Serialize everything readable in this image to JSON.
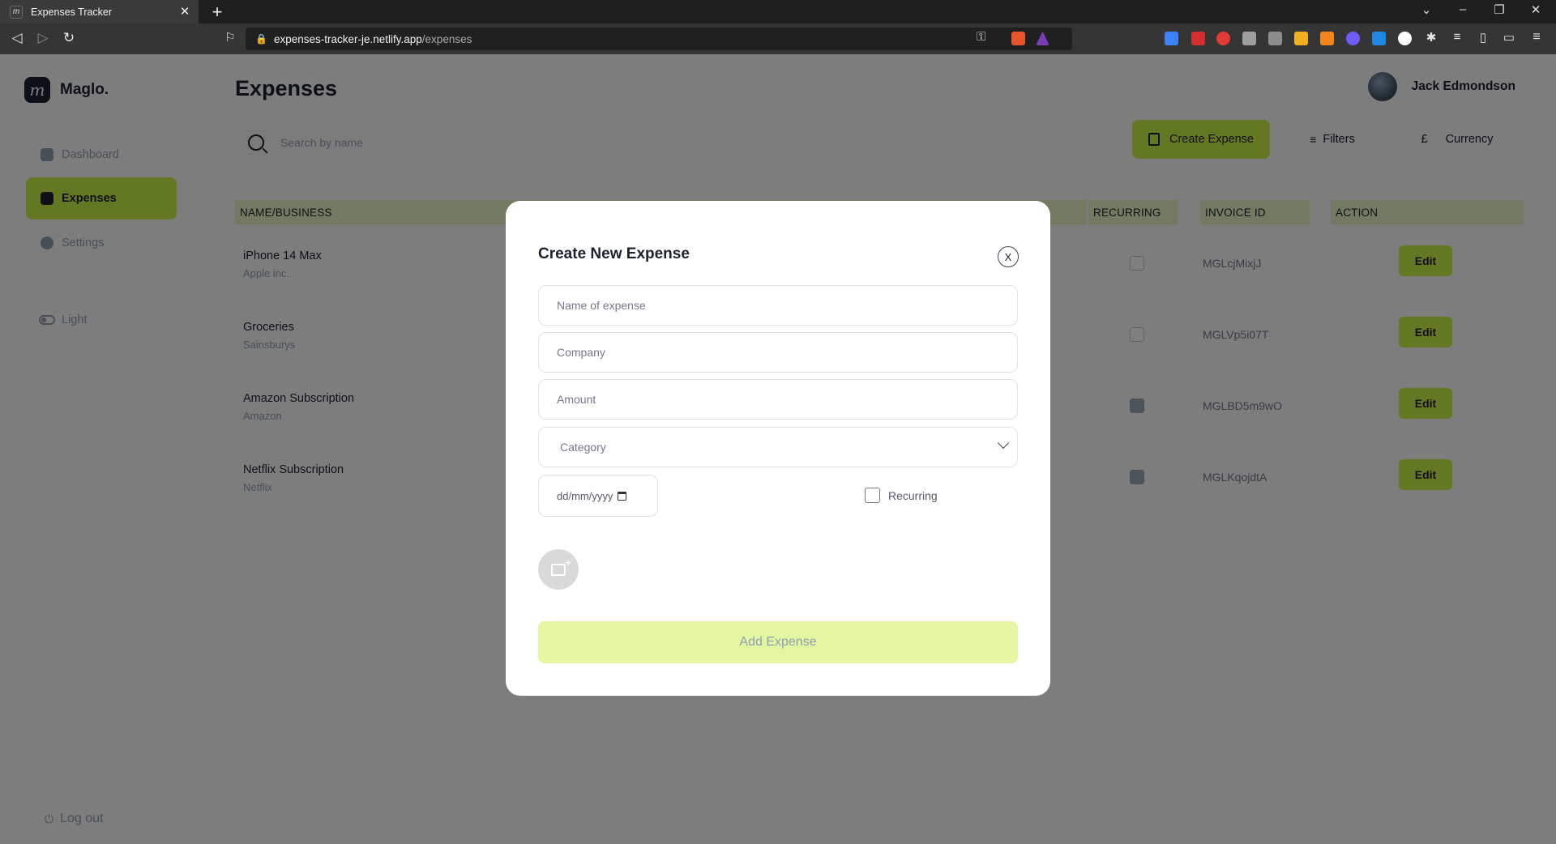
{
  "browser": {
    "tab_title": "Expenses Tracker",
    "url_host": "expenses-tracker-je.netlify.app",
    "url_path": "/expenses"
  },
  "sidebar": {
    "brand": "Maglo.",
    "items": [
      {
        "label": "Dashboard",
        "icon": "dashboard-icon"
      },
      {
        "label": "Expenses",
        "icon": "expenses-icon"
      },
      {
        "label": "Settings",
        "icon": "gear-icon"
      }
    ],
    "theme_label": "Light",
    "logout_label": "Log out"
  },
  "header": {
    "title": "Expenses",
    "user_name": "Jack Edmondson"
  },
  "toolbar": {
    "search_placeholder": "Search by name",
    "create_label": "Create Expense",
    "filters_label": "Filters",
    "currency_symbol": "£",
    "currency_label": "Currency"
  },
  "table": {
    "headers": [
      "NAME/BUSINESS",
      "RECURRING",
      "INVOICE ID",
      "ACTION"
    ],
    "rows": [
      {
        "name": "iPhone 14 Max",
        "company": "Apple inc.",
        "recurring": false,
        "invoice": "MGLcjMixjJ",
        "action": "Edit"
      },
      {
        "name": "Groceries",
        "company": "Sainsburys",
        "recurring": false,
        "invoice": "MGLVp5i07T",
        "action": "Edit"
      },
      {
        "name": "Amazon Subscription",
        "company": "Amazon",
        "recurring": true,
        "invoice": "MGLBD5m9wO",
        "action": "Edit"
      },
      {
        "name": "Netflix Subscription",
        "company": "Netflix",
        "recurring": true,
        "invoice": "MGLKqojdtA",
        "action": "Edit"
      }
    ]
  },
  "modal": {
    "title": "Create New Expense",
    "close_label": "X",
    "name_placeholder": "Name of expense",
    "company_placeholder": "Company",
    "amount_placeholder": "Amount",
    "category_placeholder": "Category",
    "date_placeholder": "dd/mm/yyyy",
    "recurring_label": "Recurring",
    "submit_label": "Add Expense"
  },
  "colors": {
    "accent": "#c8ee44",
    "text": "#1b212d",
    "muted": "#929eae"
  }
}
